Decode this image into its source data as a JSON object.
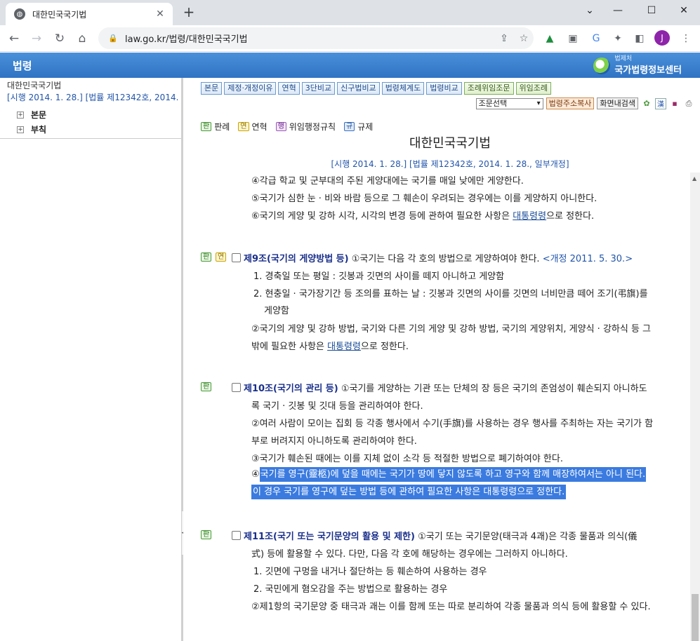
{
  "browser": {
    "tab_title": "대한민국국기법",
    "url": "law.go.kr/법령/대한민국국기법",
    "profile_initial": "J"
  },
  "site": {
    "section": "법령",
    "brand_small": "법제처",
    "brand_big": "국가법령정보센터"
  },
  "left": {
    "law_name": "대한민국국기법",
    "law_meta": "[시행 2014. 1. 28.] [법률 제12342호, 2014. 1.",
    "tree": [
      "본문",
      "부칙"
    ]
  },
  "toolbar": {
    "buttons": [
      "본문",
      "제정·개정이유",
      "연혁",
      "3단비교",
      "신구법비교",
      "법령체계도",
      "법령비교"
    ],
    "green_buttons": [
      "조례위임조문",
      "위임조례"
    ],
    "select_value": "조문선택",
    "copy_button": "법령주소복사",
    "search_button": "화면내검색"
  },
  "legend": [
    {
      "badge": "판",
      "label": "판례"
    },
    {
      "badge": "연",
      "label": "연혁"
    },
    {
      "badge": "행",
      "label": "위임행정규칙"
    },
    {
      "badge": "규",
      "label": "규제"
    }
  ],
  "doc": {
    "title": "대한민국국기법",
    "meta": "[시행 2014. 1. 28.] [법률 제12342호, 2014. 1. 28., 일부개정]"
  },
  "text": {
    "p4": "④각급 학교 및 군부대의 주된 게양대에는 국기를 매일 낮에만 게양한다.",
    "p5": "⑤국기가 심한 눈 · 비와 바람 등으로 그 훼손이 우려되는 경우에는 이를 게양하지 아니한다.",
    "p6a": "⑥국기의 게양 및 강하 시각, 시각의 변경 등에 관하여 필요한 사항은 ",
    "p6link": "대통령령",
    "p6b": "으로 정한다.",
    "a9_head": "제9조(국기의 게양방법 등)",
    "a9_body": " ①국기는 다음 각 호의 방법으로 게양하여야 한다. ",
    "a9_amend": "<개정 2011. 5. 30.>",
    "a9_1": "1. 경축일 또는 평일 : 깃봉과 깃면의 사이를 떼지 아니하고 게양함",
    "a9_2a": "2. 현충일 · 국가장기간 등 조의를 표하는 날 : 깃봉과 깃면의 사이를 깃면의 너비만큼 떼어 조기(弔旗)를",
    "a9_2b": "게양함",
    "a9_p2a": "②국기의 게양 및 강하 방법, 국기와 다른 기의 게양 및 강하 방법, 국기의 게양위치, 게양식 · 강하식 등 그",
    "a9_p2b": "밖에 필요한 사항은 ",
    "a9_p2link": "대통령령",
    "a9_p2c": "으로 정한다.",
    "a10_head": "제10조(국기의 관리 등)",
    "a10_body": " ①국기를 게양하는 기관 또는 단체의 장 등은 국기의 존엄성이 훼손되지 아니하도",
    "a10_1b": "록 국기 · 깃봉 및 깃대 등을 관리하여야 한다.",
    "a10_2a": "②여러 사람이 모이는 집회 등 각종 행사에서 수기(手旗)를 사용하는 경우 행사를 주최하는 자는 국기가 함",
    "a10_2b": "부로 버려지지 아니하도록 관리하여야 한다.",
    "a10_3": "③국기가 훼손된 때에는 이를 지체 없이 소각 등 적절한 방법으로 폐기하여야 한다.",
    "a10_4mark": "④",
    "a10_4a": "국기를 영구(靈柩)에 덮을 때에는 국기가 땅에 닿지 않도록 하고 영구와 함께 매장하여서는 아니 된다.",
    "a10_4b": "이 경우 국기를 영구에 덮는 방법 등에 관하여 필요한 사항은 대통령령으로 정한다.",
    "a11_head": "제11조(국기 또는 국기문양의 활용 및 제한)",
    "a11_body": " ①국기 또는 국기문양(태극과 4괘)은 각종 물품과 의식(儀",
    "a11_1b": "式) 등에 활용할 수 있다. 다만, 다음 각 호에 해당하는 경우에는 그러하지 아니하다.",
    "a11_i1": "1. 깃면에 구멍을 내거나 절단하는 등 훼손하여 사용하는 경우",
    "a11_i2": "2. 국민에게 혐오감을 주는 방법으로 활용하는 경우",
    "a11_p2": "②제1항의 국기문양 중 태극과 괘는 이를 함께 또는 따로 분리하여 각종 물품과 의식 등에 활용할 수 있다."
  },
  "badges": {
    "pan": "판",
    "yeon": "연"
  }
}
